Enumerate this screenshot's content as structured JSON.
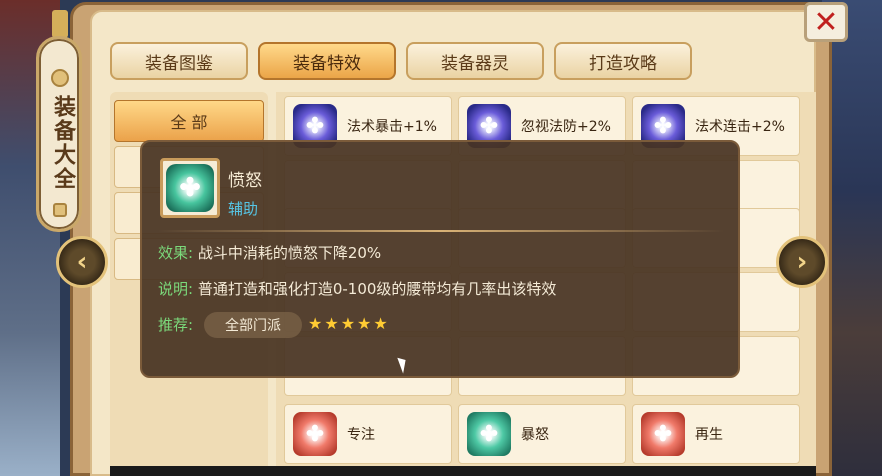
{
  "window": {
    "title": "装备大全",
    "close_label": "✕"
  },
  "tabs": [
    {
      "label": "装备图鉴",
      "active": false
    },
    {
      "label": "装备特效",
      "active": true
    },
    {
      "label": "装备器灵",
      "active": false
    },
    {
      "label": "打造攻略",
      "active": false
    }
  ],
  "categories": [
    {
      "label": "全 部",
      "active": true
    }
  ],
  "effects": [
    {
      "label": "法术暴击+1%",
      "icon": "blue-swirl-icon"
    },
    {
      "label": "忽视法防+2%",
      "icon": "blue-swirl-icon"
    },
    {
      "label": "法术连击+2%",
      "icon": "blue-swirl-icon"
    },
    {
      "label": "专注",
      "icon": "red-swirl-icon"
    },
    {
      "label": "暴怒",
      "icon": "green-swirl-icon"
    },
    {
      "label": "再生",
      "icon": "red-swirl-icon"
    }
  ],
  "tooltip": {
    "name": "愤怒",
    "type": "辅助",
    "effect_key": "效果:",
    "effect_text": "战斗中消耗的愤怒下降20%",
    "desc_key": "说明:",
    "desc_text": "普通打造和强化打造0-100级的腰带均有几率出该特效",
    "recommend_key": "推荐:",
    "recommend_tag": "全部门派",
    "rating": 5,
    "stars": "★★★★★"
  },
  "colors": {
    "tab_active": "#eba548",
    "tooltip_bg": "#483422",
    "key_green": "#7bd97b",
    "type_blue": "#56c6e6",
    "close_red": "#c0201e"
  }
}
